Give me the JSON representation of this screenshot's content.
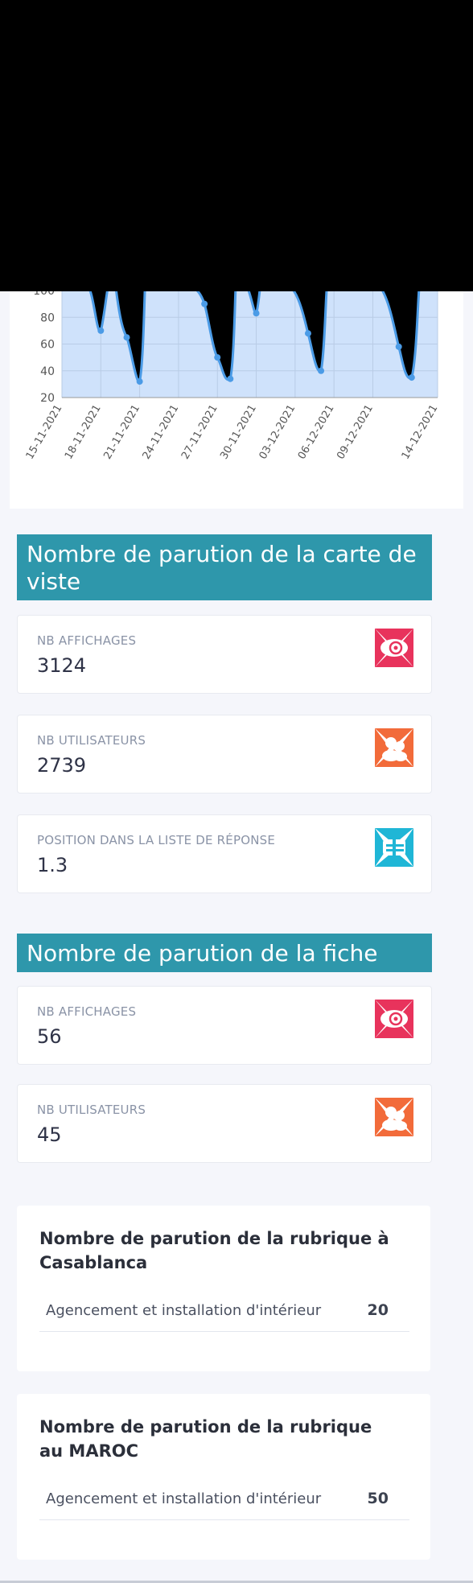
{
  "chart_data": {
    "type": "area",
    "x_ticks": [
      "15-11-2021",
      "18-11-2021",
      "21-11-2021",
      "24-11-2021",
      "27-11-2021",
      "30-11-2021",
      "03-12-2021",
      "06-12-2021",
      "09-12-2021",
      "14-12-2021"
    ],
    "y_ticks": [
      20,
      40,
      60,
      80,
      100
    ],
    "ylim": [
      20,
      100
    ],
    "grid": true,
    "color": "#4b9be6",
    "fill": "#cfe2fb",
    "points": [
      {
        "x": "18-11-2021",
        "y": 70
      },
      {
        "x": "20-11-2021",
        "y": 65
      },
      {
        "x": "21-11-2021",
        "y": 32
      },
      {
        "x": "26-11-2021",
        "y": 90
      },
      {
        "x": "27-11-2021",
        "y": 50
      },
      {
        "x": "28-11-2021",
        "y": 34
      },
      {
        "x": "30-11-2021",
        "y": 83
      },
      {
        "x": "04-12-2021",
        "y": 68
      },
      {
        "x": "05-12-2021",
        "y": 40
      },
      {
        "x": "11-12-2021",
        "y": 58
      },
      {
        "x": "12-12-2021",
        "y": 35
      }
    ]
  },
  "carte": {
    "title": "Nombre de parution de la carte de viste",
    "stats": [
      {
        "label": "NB AFFICHAGES",
        "value": "3124",
        "icon": "eye-icon",
        "color": "#e8335c"
      },
      {
        "label": "NB UTILISATEURS",
        "value": "2739",
        "icon": "users-icon",
        "color": "#f26b3a"
      },
      {
        "label": "POSITION DANS LA LISTE DE RÉPONSE",
        "value": "1.3",
        "icon": "position-icon",
        "color": "#1fb6d6"
      }
    ]
  },
  "fiche": {
    "title": "Nombre de parution de la fiche",
    "stats": [
      {
        "label": "NB AFFICHAGES",
        "value": "56",
        "icon": "eye-icon",
        "color": "#e8335c"
      },
      {
        "label": "NB UTILISATEURS",
        "value": "45",
        "icon": "users-icon",
        "color": "#f26b3a"
      }
    ]
  },
  "rubrique_casa": {
    "title": "Nombre de parution de la rubrique à Casablanca",
    "rows": [
      {
        "name": "Agencement et installation d'intérieur",
        "value": "20"
      }
    ]
  },
  "rubrique_maroc": {
    "title": "Nombre de parution de la rubrique au MAROC",
    "rows": [
      {
        "name": "Agencement et installation d'intérieur",
        "value": "50"
      }
    ]
  }
}
